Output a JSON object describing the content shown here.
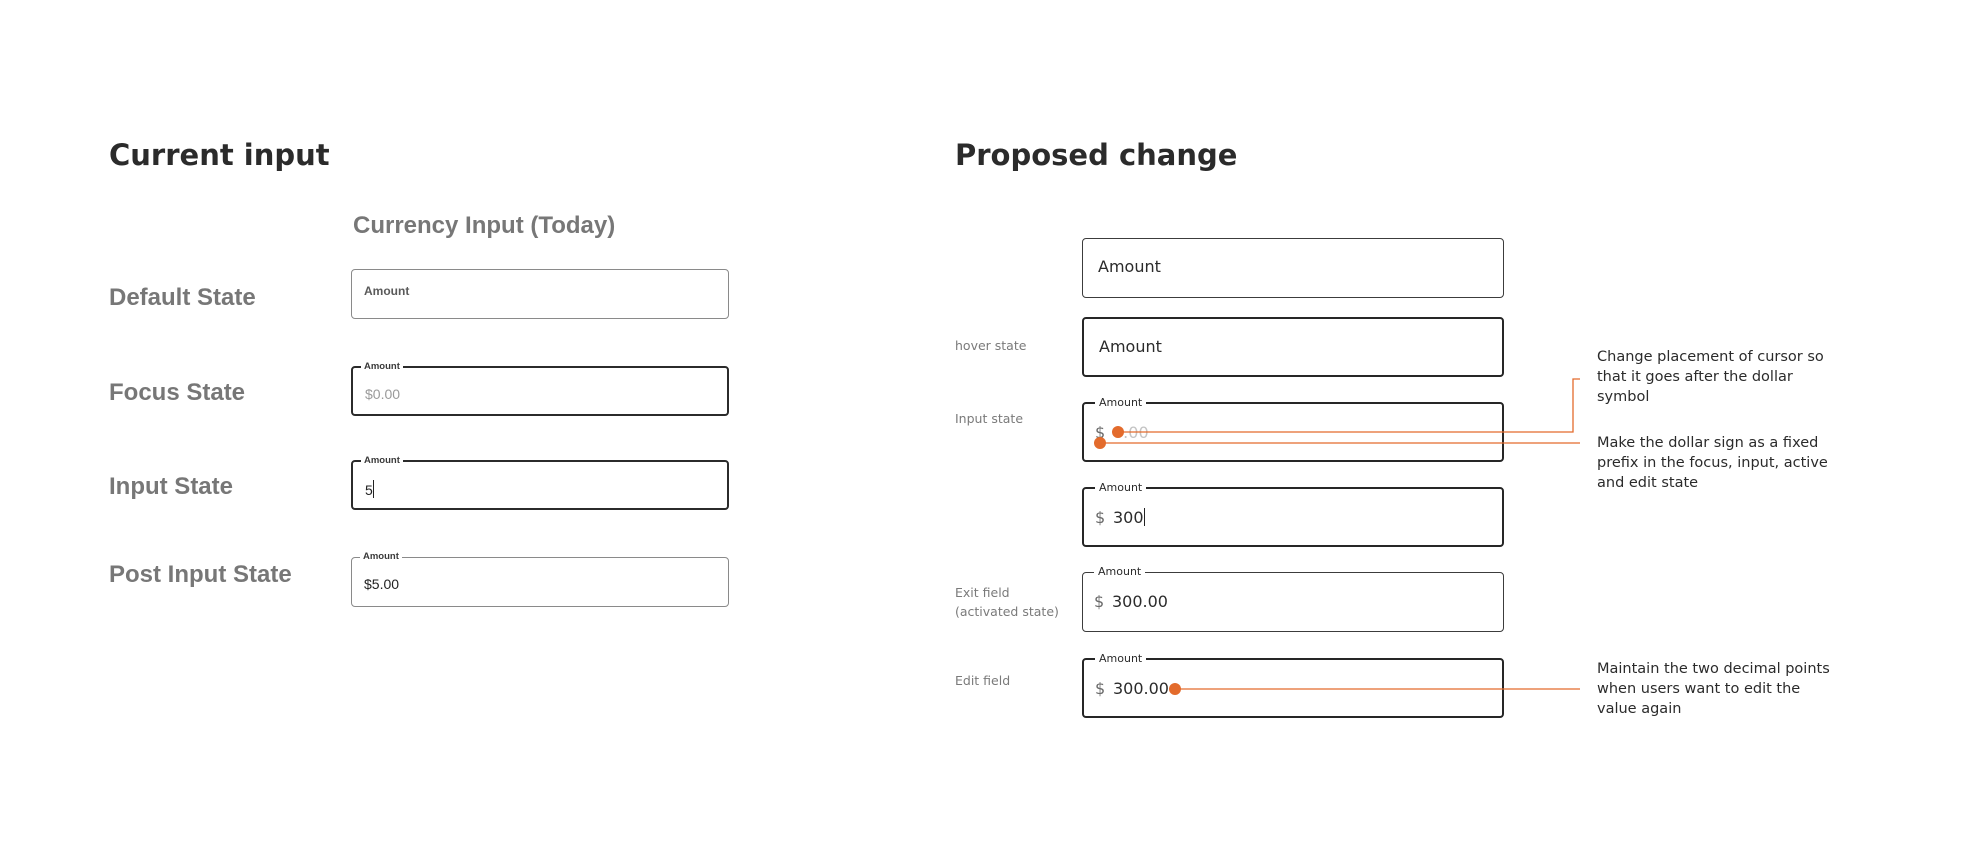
{
  "left": {
    "title": "Current input",
    "subtitle": "Currency Input (Today)",
    "rows": [
      {
        "label": "Default State",
        "placeholder": "Amount"
      },
      {
        "label": "Focus State",
        "legend": "Amount",
        "value": "$0.00"
      },
      {
        "label": "Input State",
        "legend": "Amount",
        "value": "5"
      },
      {
        "label": "Post Input State",
        "legend": "Amount",
        "value": "$5.00"
      }
    ]
  },
  "right": {
    "title": "Proposed change",
    "rows": [
      {
        "label": "",
        "placeholder": "Amount"
      },
      {
        "label": "hover state",
        "placeholder": "Amount"
      },
      {
        "label": "Input state",
        "legend": "Amount",
        "prefix": "$",
        "value": "0.00"
      },
      {
        "label": "",
        "legend": "Amount",
        "prefix": "$",
        "value": "300"
      },
      {
        "label_lines": [
          "Exit field",
          "(activated state)"
        ],
        "legend": "Amount",
        "prefix": "$",
        "value": "300.00"
      },
      {
        "label": "Edit field",
        "legend": "Amount",
        "prefix": "$",
        "value": "300.00"
      }
    ],
    "notes": [
      {
        "lines": [
          "Change placement of cursor so",
          "that it goes after the dollar",
          "symbol"
        ]
      },
      {
        "lines": [
          "Make the dollar sign as a fixed",
          "prefix in the focus, input, active",
          "and edit state"
        ]
      },
      {
        "lines": [
          "Maintain the two decimal points",
          "when users want to edit the",
          "value again"
        ]
      }
    ]
  },
  "colors": {
    "annotation": "#e36b2c",
    "title": "#2b2b2b",
    "muted_label": "#777777"
  }
}
